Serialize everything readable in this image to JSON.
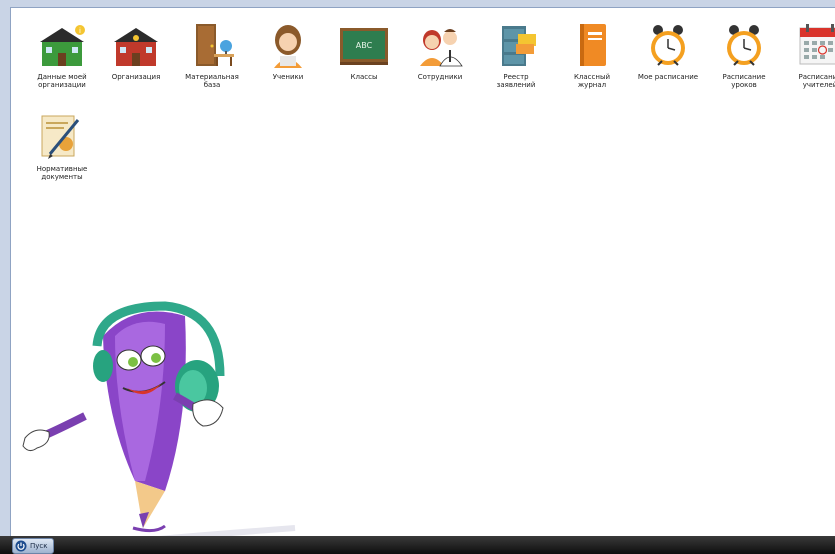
{
  "desktop": {
    "icons": [
      {
        "icon": "green-school-icon",
        "label": "Данные моей\nорганизации"
      },
      {
        "icon": "red-school-icon",
        "label": "Организация"
      },
      {
        "icon": "door-and-desk-icon",
        "label": "Материальная\nбаза"
      },
      {
        "icon": "student-girl-icon",
        "label": "Ученики"
      },
      {
        "icon": "chalkboard-icon",
        "label": "Классы"
      },
      {
        "icon": "staff-people-icon",
        "label": "Сотрудники"
      },
      {
        "icon": "filing-cabinet-icon",
        "label": "Реестр\nзаявлений"
      },
      {
        "icon": "orange-notebook-icon",
        "label": "Классный\nжурнал"
      },
      {
        "icon": "alarm-clock-icon",
        "label": "Мое расписание"
      },
      {
        "icon": "alarm-clock-icon",
        "label": "Расписание\nуроков"
      },
      {
        "icon": "calendar-icon",
        "label": "Расписание\nучителей"
      },
      {
        "icon": "documents-pen-icon",
        "label": "Нормативные\nдокументы"
      }
    ]
  },
  "mascot": {
    "icon": "pencil-mascot-headphones-icon"
  },
  "taskbar": {
    "start_label": "Пуск",
    "start_icon": "power-icon"
  },
  "colors": {
    "taskbar": "#1a1a1a",
    "desktop_border": "#c9d4e6",
    "background": "#ffffff"
  }
}
